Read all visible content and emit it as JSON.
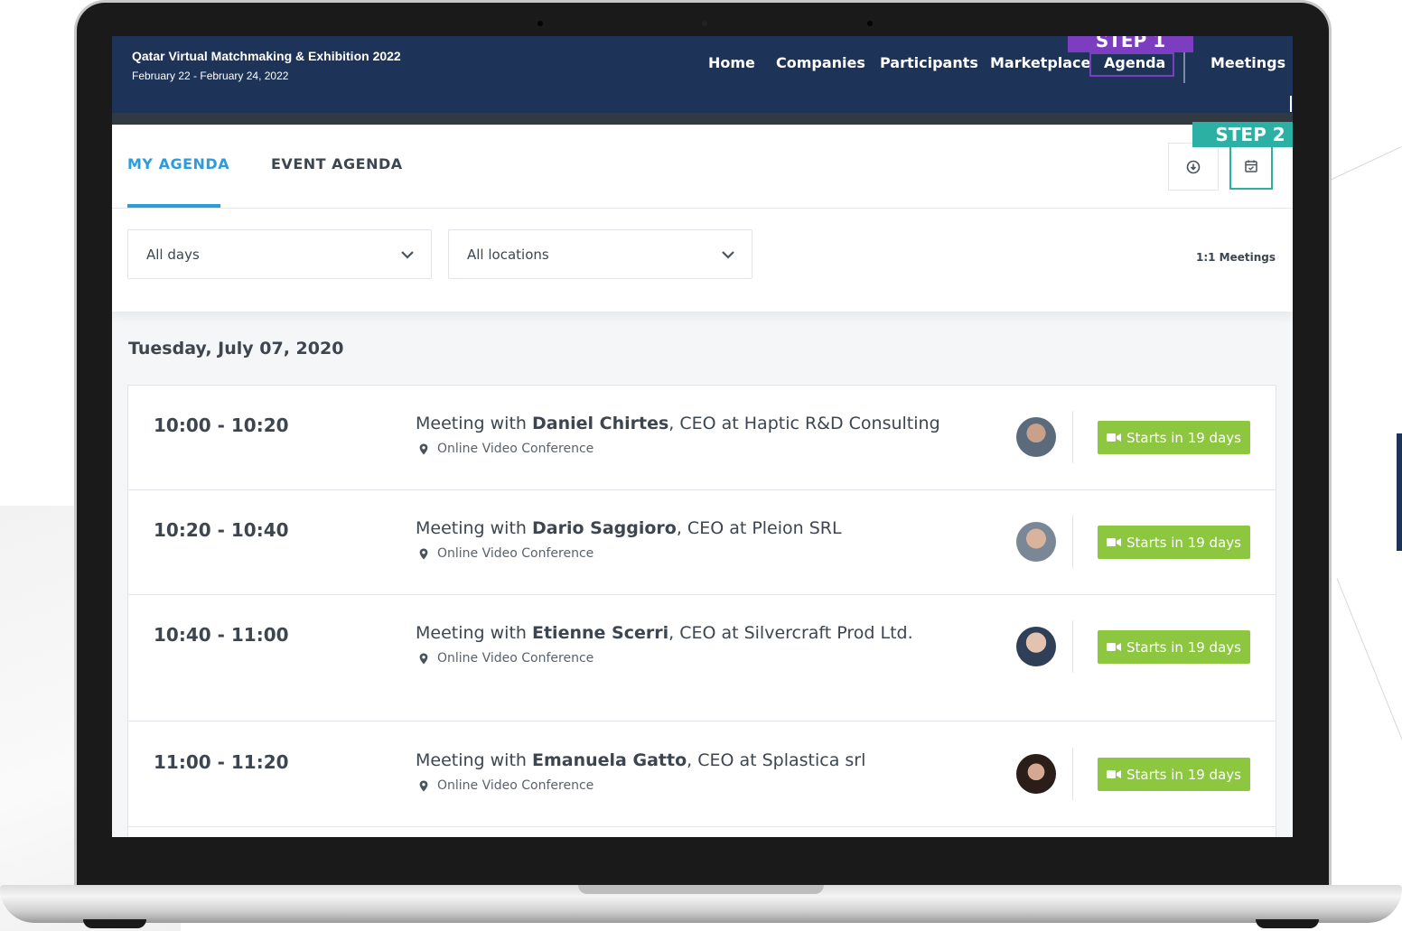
{
  "colors": {
    "header_bg": "#1d3358",
    "accent_blue": "#2d9cdb",
    "step1": "#7c3dc0",
    "step2": "#2db0a4",
    "start_button": "#8dc63f"
  },
  "header": {
    "event_title": "Qatar Virtual Matchmaking & Exhibition 2022",
    "event_dates": "February 22 - February 24, 2022",
    "nav": {
      "home": "Home",
      "companies": "Companies",
      "participants": "Participants",
      "marketplace": "Marketplace",
      "agenda": "Agenda",
      "meetings": "Meetings"
    }
  },
  "annotations": {
    "step1": "STEP 1",
    "step2": "STEP 2"
  },
  "tabs": {
    "my_agenda": "MY AGENDA",
    "event_agenda": "EVENT AGENDA"
  },
  "toolbar": {
    "download_icon": "download-circle-icon",
    "calendar_icon": "calendar-check-icon"
  },
  "filters": {
    "days": "All days",
    "locations": "All locations",
    "meeting_type": "1:1 Meetings"
  },
  "day_heading": "Tuesday, July 07, 2020",
  "meetings": [
    {
      "time": "10:00 - 10:20",
      "prefix": "Meeting with ",
      "name": "Daniel Chirtes",
      "suffix": ", CEO at Haptic R&D Consulting",
      "location": "Online Video Conference",
      "button": "Starts in 19 days"
    },
    {
      "time": "10:20 - 10:40",
      "prefix": "Meeting with ",
      "name": "Dario Saggioro",
      "suffix": ", CEO at Pleion SRL",
      "location": "Online Video Conference",
      "button": "Starts in 19 days"
    },
    {
      "time": "10:40 - 11:00",
      "prefix": "Meeting with ",
      "name": "Etienne Scerri",
      "suffix": ", CEO at Silvercraft Prod Ltd.",
      "location": "Online Video Conference",
      "button": "Starts in 19 days"
    },
    {
      "time": "11:00 - 11:20",
      "prefix": "Meeting with ",
      "name": "Emanuela Gatto",
      "suffix": ", CEO at Splastica srl",
      "location": "Online Video Conference",
      "button": "Starts in 19 days"
    }
  ]
}
